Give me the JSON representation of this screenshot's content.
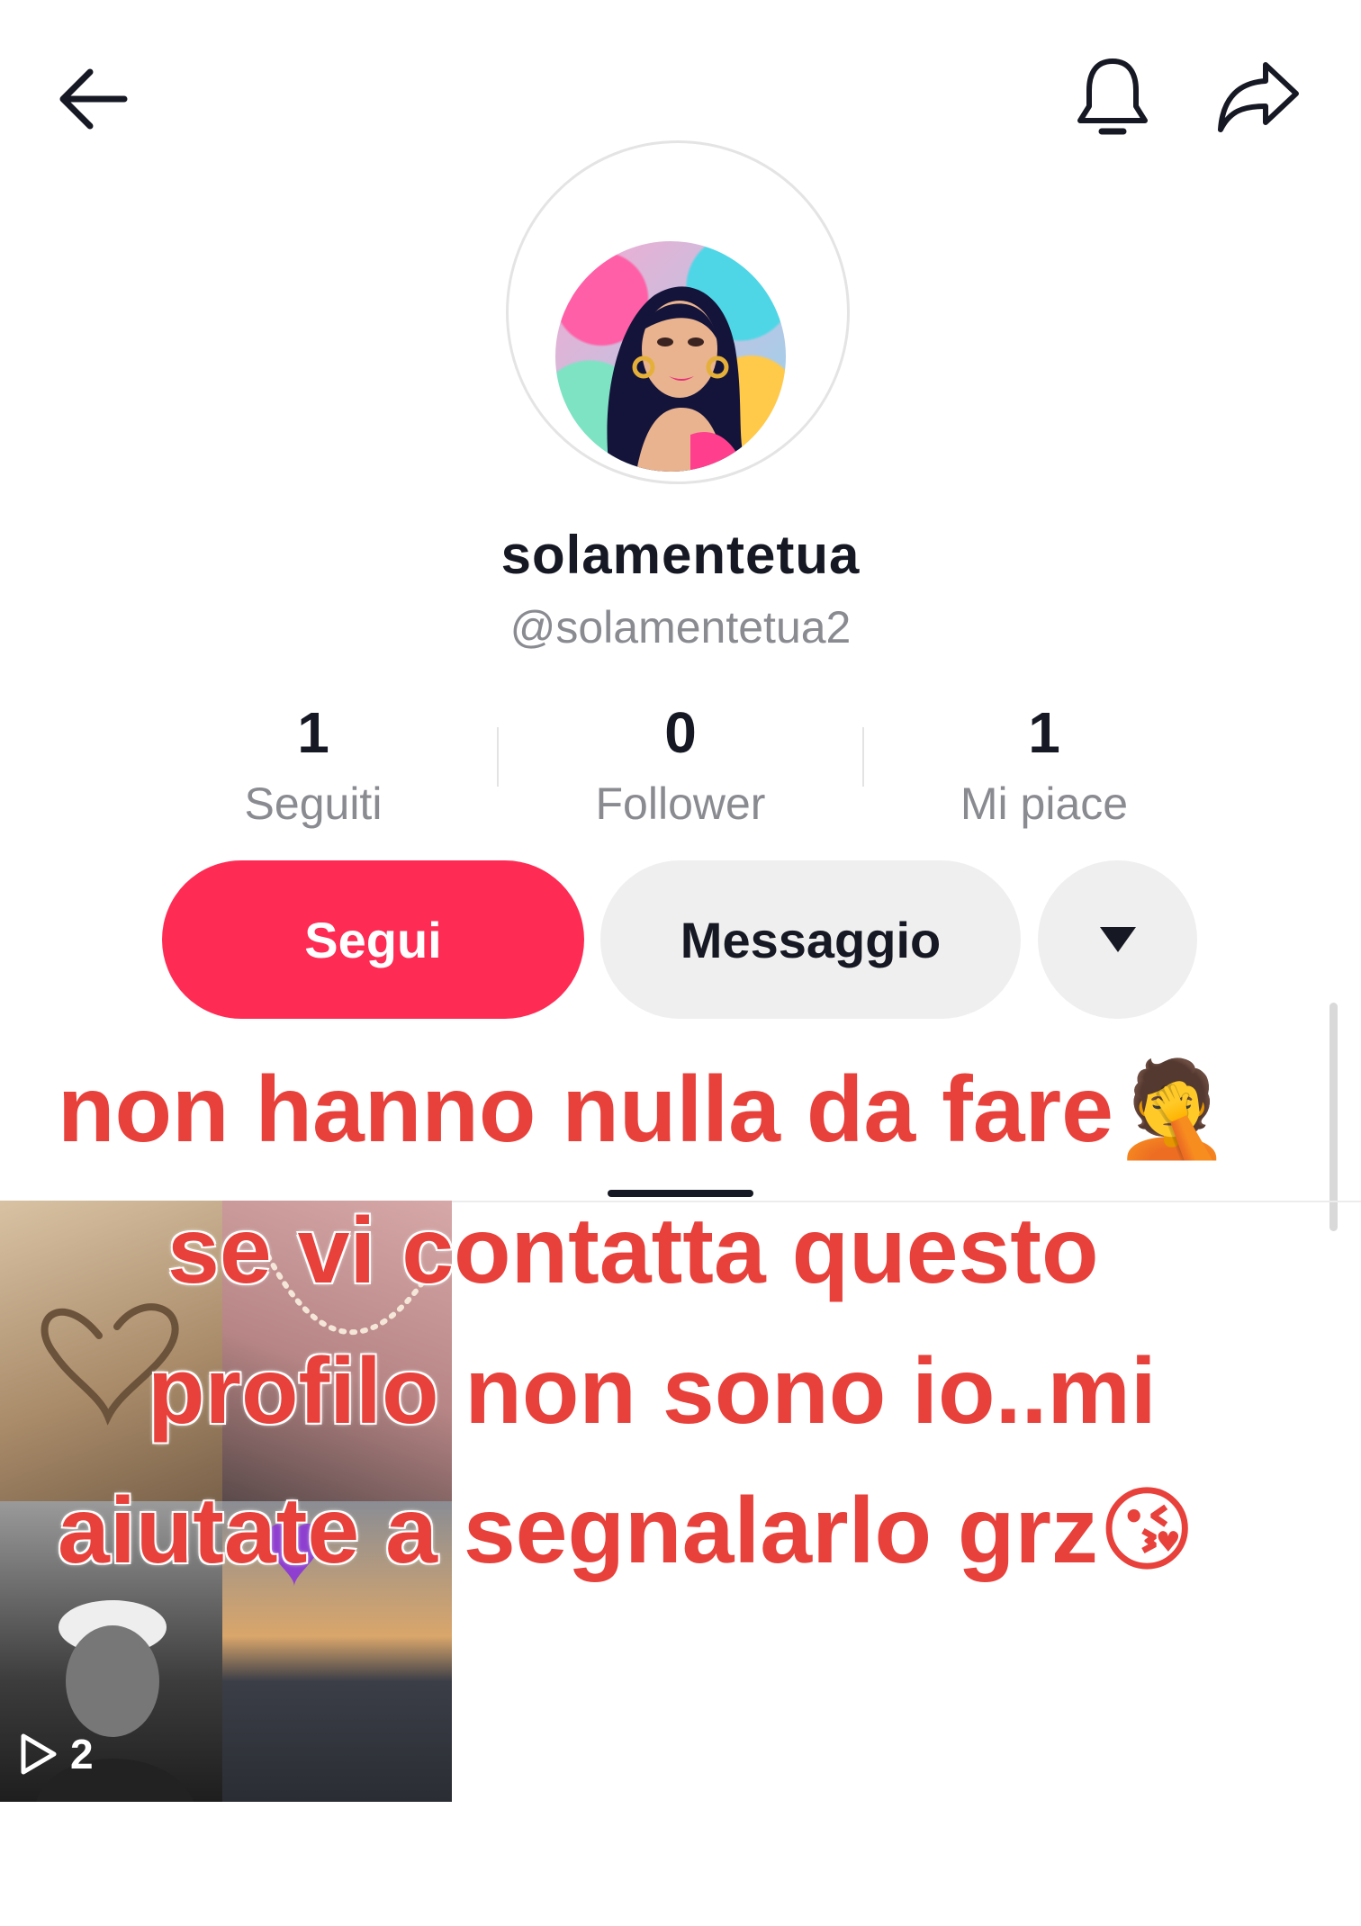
{
  "profile": {
    "display_name": "solamentetua",
    "handle": "@solamentetua2"
  },
  "stats": [
    {
      "value": "1",
      "label": "Seguiti"
    },
    {
      "value": "0",
      "label": "Follower"
    },
    {
      "value": "1",
      "label": "Mi piace"
    }
  ],
  "actions": {
    "follow_label": "Segui",
    "message_label": "Messaggio"
  },
  "videos": {
    "play_count": "2"
  },
  "overlay": {
    "line1": "non hanno nulla da fare",
    "line1_emoji": "🤦",
    "line2": "se vi contatta questo",
    "line3": "profilo non sono io..mi",
    "line4": "aiutate a segnalarlo grz",
    "line4_emoji": "😘"
  },
  "colors": {
    "accent": "#fe2c55",
    "overlay_text": "#e8403b"
  },
  "icons": [
    "back-arrow-icon",
    "bell-icon",
    "share-icon",
    "dropdown-triangle-icon",
    "play-icon"
  ]
}
